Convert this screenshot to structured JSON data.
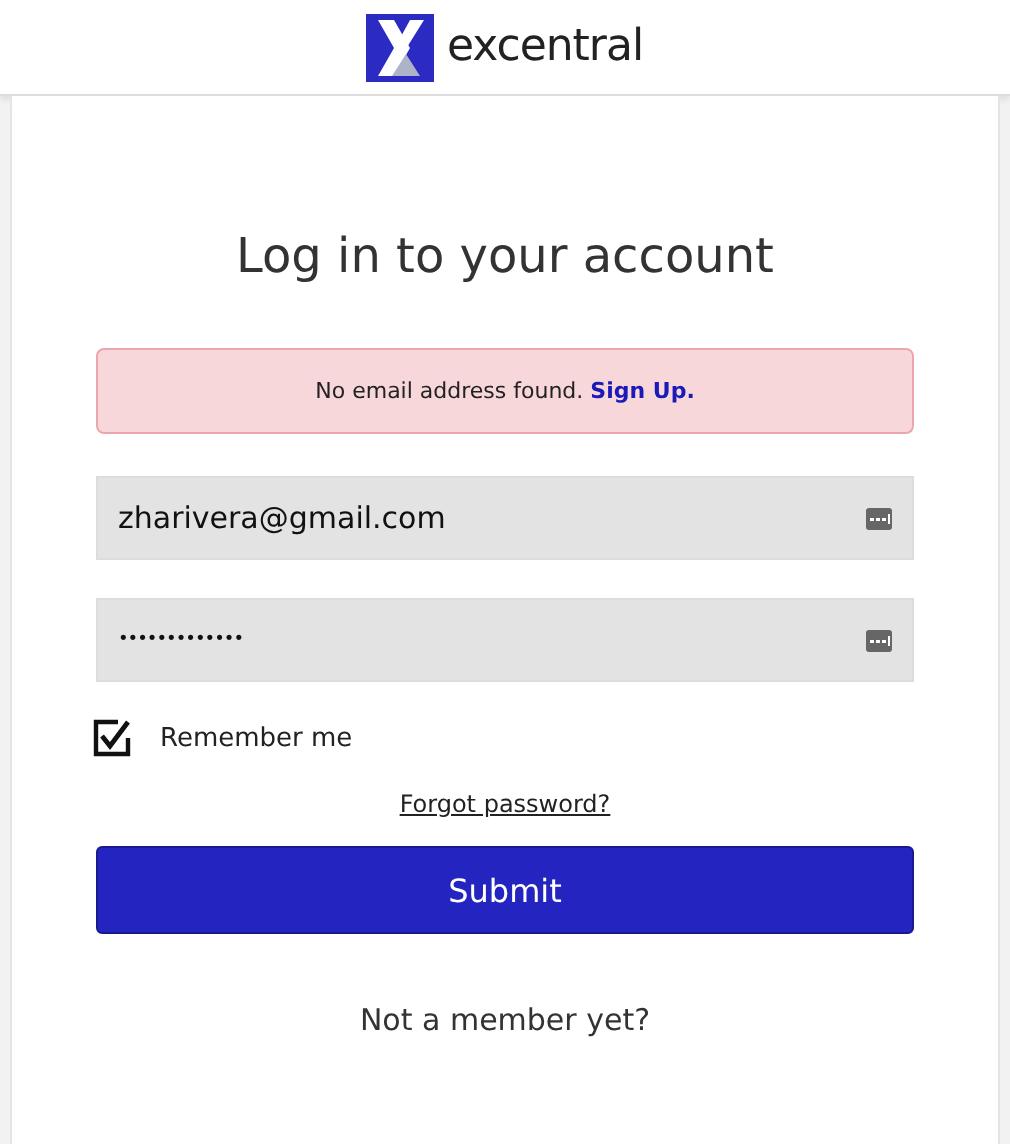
{
  "header": {
    "brand": "excentral"
  },
  "title": "Log in to your account",
  "alert": {
    "message": "No email address found.",
    "link": "Sign Up."
  },
  "fields": [
    {
      "kind": "email",
      "value": "zharivera@gmail.com"
    },
    {
      "kind": "password",
      "value": "•••••••••••••"
    }
  ],
  "remember": {
    "label": "Remember me",
    "checked": true
  },
  "forgot_link": "Forgot password?",
  "submit": "Submit",
  "footer_text": "Not a member yet?"
}
